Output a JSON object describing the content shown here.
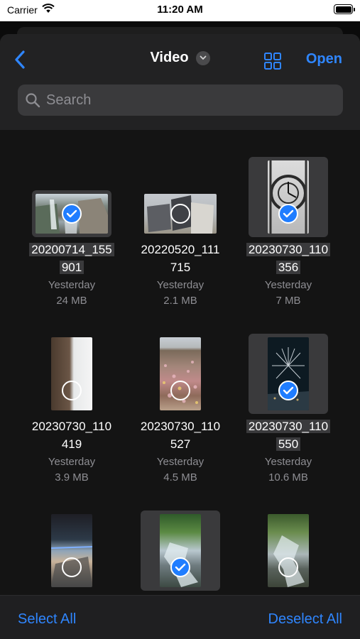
{
  "status_bar": {
    "carrier": "Carrier",
    "time": "11:20 AM"
  },
  "header": {
    "title": "Video",
    "open_label": "Open"
  },
  "search": {
    "placeholder": "Search"
  },
  "files": [
    {
      "name_1": "20200714_155",
      "name_2": "901",
      "date": "Yesterday",
      "size": "24 MB",
      "selected": true
    },
    {
      "name_1": "20220520_111",
      "name_2": "715",
      "date": "Yesterday",
      "size": "2.1 MB",
      "selected": false
    },
    {
      "name_1": "20230730_110",
      "name_2": "356",
      "date": "Yesterday",
      "size": "7 MB",
      "selected": true
    },
    {
      "name_1": "20230730_110",
      "name_2": "419",
      "date": "Yesterday",
      "size": "3.9 MB",
      "selected": false
    },
    {
      "name_1": "20230730_110",
      "name_2": "527",
      "date": "Yesterday",
      "size": "4.5 MB",
      "selected": false
    },
    {
      "name_1": "20230730_110",
      "name_2": "550",
      "date": "Yesterday",
      "size": "10.6 MB",
      "selected": true
    },
    {
      "name_1": "",
      "name_2": "",
      "date": "",
      "size": "",
      "selected": false
    },
    {
      "name_1": "",
      "name_2": "",
      "date": "",
      "size": "",
      "selected": true
    },
    {
      "name_1": "",
      "name_2": "",
      "date": "",
      "size": "",
      "selected": false
    }
  ],
  "toolbar": {
    "select_all": "Select All",
    "deselect_all": "Deselect All"
  },
  "colors": {
    "accent": "#2f86ff",
    "check_fill": "#1f7dff",
    "background": "#141414"
  }
}
